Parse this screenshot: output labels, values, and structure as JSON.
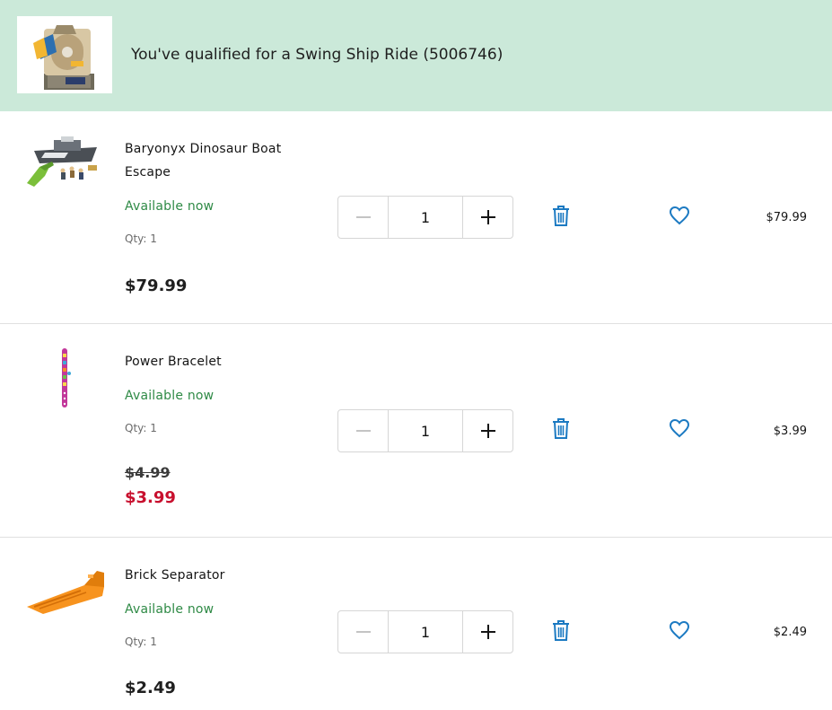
{
  "banner": {
    "message": "You've qualified for a Swing Ship Ride (5006746)"
  },
  "items": [
    {
      "name": "Baryonyx Dinosaur Boat Escape",
      "availability": "Available now",
      "qty_label": "Qty: 1",
      "price": "$79.99",
      "quantity": "1",
      "line_total": "$79.99"
    },
    {
      "name": "Power Bracelet",
      "availability": "Available now",
      "qty_label": "Qty: 1",
      "original_price": "$4.99",
      "sale_price": "$3.99",
      "quantity": "1",
      "line_total": "$3.99"
    },
    {
      "name": "Brick Separator",
      "availability": "Available now",
      "qty_label": "Qty: 1",
      "price": "$2.49",
      "quantity": "1",
      "line_total": "$2.49"
    }
  ],
  "icons": {
    "decrease": "minus-icon",
    "increase": "plus-icon",
    "remove": "trash-icon",
    "wishlist": "heart-icon"
  },
  "colors": {
    "banner_bg": "#cbe9d9",
    "available": "#2f8a46",
    "sale": "#c8102e",
    "action_icon": "#1c7ac2"
  }
}
